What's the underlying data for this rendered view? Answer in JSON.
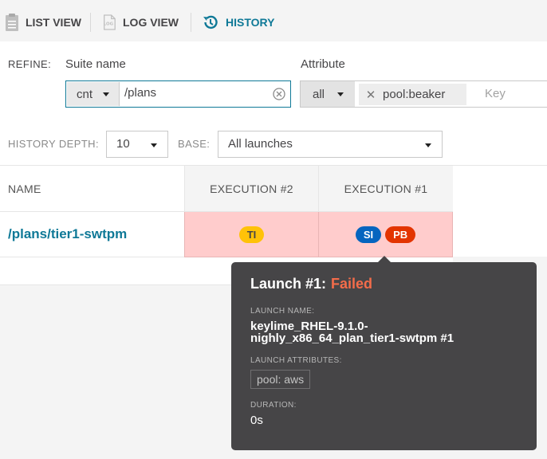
{
  "tabs": [
    {
      "label": "LIST VIEW",
      "icon": "clipboard-icon"
    },
    {
      "label": "LOG VIEW",
      "icon": "log-icon"
    },
    {
      "label": "HISTORY",
      "icon": "history-icon"
    }
  ],
  "refine": {
    "label": "REFINE:",
    "suite_name": {
      "title": "Suite name",
      "condition": "cnt",
      "value": "/plans"
    },
    "attribute": {
      "title": "Attribute",
      "condition": "all",
      "tag": "pool:beaker",
      "key_placeholder": "Key"
    }
  },
  "history_depth": {
    "label": "HISTORY DEPTH:",
    "value": "10"
  },
  "base": {
    "label": "BASE:",
    "value": "All launches"
  },
  "table": {
    "columns": [
      "NAME",
      "EXECUTION #2",
      "EXECUTION #1"
    ],
    "rows": [
      {
        "name": "/plans/tier1-swtpm",
        "execution_2": [
          {
            "label": "TI",
            "color": "#ffc208",
            "text_color": "#464547"
          }
        ],
        "execution_1": [
          {
            "label": "SI",
            "color": "#0565bf",
            "text_color": "#ffffff"
          },
          {
            "label": "PB",
            "color": "#e33400",
            "text_color": "#ffffff"
          }
        ]
      }
    ]
  },
  "tooltip": {
    "title": "Launch #1:",
    "status": "Failed",
    "status_color": "#f36c4a",
    "launch_name_label": "LAUNCH NAME:",
    "launch_name": "keylime_RHEL-9.1.0-nighly_x86_64_plan_tier1-swtpm #1",
    "attributes_label": "LAUNCH ATTRIBUTES:",
    "attributes": [
      "pool: aws"
    ],
    "duration_label": "DURATION:",
    "duration": "0s"
  },
  "colors": {
    "accent": "#0f7997",
    "failed_row": "#ffcccc",
    "tooltip_bg": "#464547"
  }
}
